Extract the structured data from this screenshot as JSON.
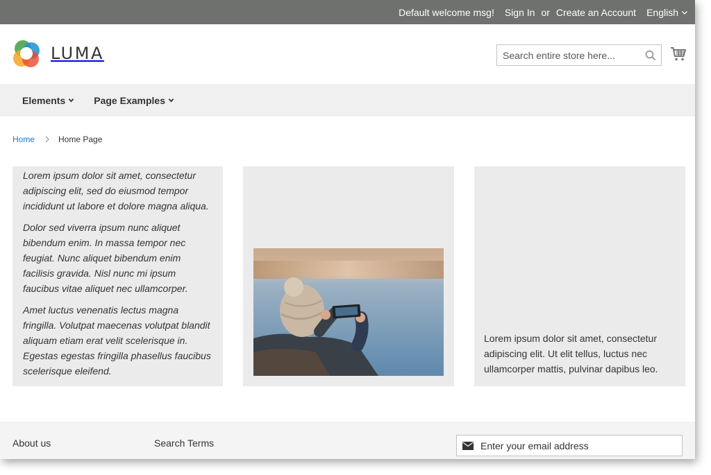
{
  "top_panel": {
    "welcome": "Default welcome msg!",
    "sign_in": "Sign In",
    "or": "or",
    "create_account": "Create an Account",
    "language": "English"
  },
  "header": {
    "logo_text": "LUMA",
    "search_placeholder": "Search entire store here...",
    "icons": {
      "search": "search-icon",
      "cart": "cart-icon"
    }
  },
  "nav": {
    "items": [
      {
        "label": "Elements"
      },
      {
        "label": "Page Examples"
      }
    ]
  },
  "breadcrumb": {
    "home": "Home",
    "current": "Home Page"
  },
  "content": {
    "col1_paragraphs": [
      "Lorem ipsum dolor sit amet, consectetur adipiscing elit, sed do eiusmod tempor incididunt ut labore et dolore magna aliqua.",
      "Dolor sed viverra ipsum nunc aliquet bibendum enim. In massa tempor nec feugiat. Nunc aliquet bibendum enim facilisis gravida. Nisl nunc mi ipsum faucibus vitae aliquet nec ullamcorper.",
      "Amet luctus venenatis lectus magna fringilla. Volutpat maecenas volutpat blandit aliquam etiam erat velit scelerisque in. Egestas egestas fringilla phasellus faucibus scelerisque eleifend."
    ],
    "col3_text": "Lorem ipsum dolor sit amet, consectetur adipiscing elit. Ut elit tellus, luctus nec ullamcorper mattis, pulvinar dapibus leo."
  },
  "footer": {
    "about": "About us",
    "search_terms": "Search Terms",
    "newsletter_placeholder": "Enter your email address"
  },
  "colors": {
    "top_panel_bg": "#6e716e",
    "nav_bg": "#f0f0f0",
    "link": "#1979c3",
    "column_bg": "#ebebeb"
  }
}
